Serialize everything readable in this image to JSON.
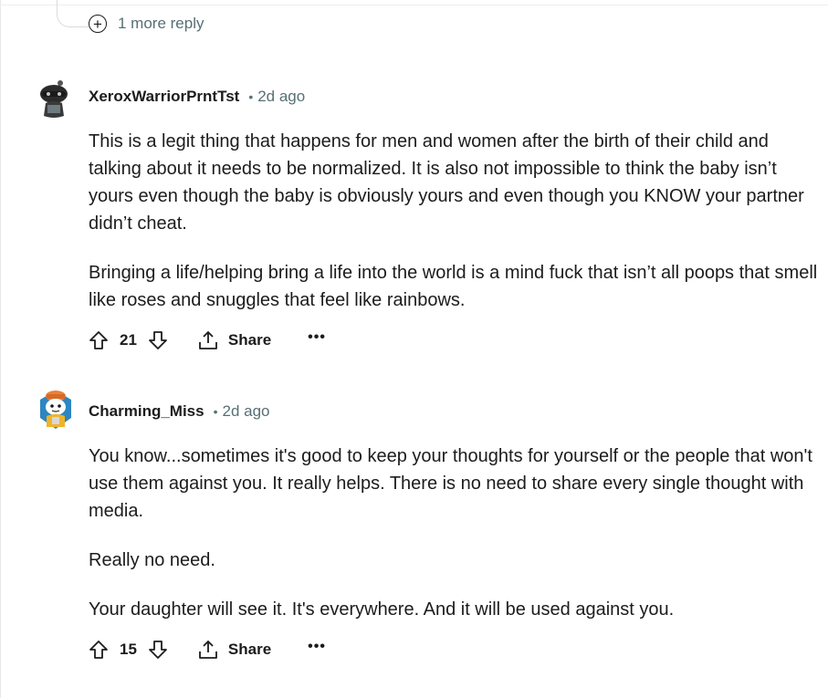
{
  "thread": {
    "more_replies_label": "1 more reply"
  },
  "comments": [
    {
      "author": "XeroxWarriorPrntTst",
      "dot": "•",
      "time": "2d ago",
      "avatar_icon": "snoo-avatar-dark",
      "paragraphs": [
        "This is a legit thing that happens for men and women after the birth of their child and talking about it needs to be normalized. It is also not impossible to think the baby isn’t yours even though the baby is obviously yours and even though you KNOW your partner didn’t cheat.",
        "Bringing a life/helping bring a life into the world is a mind fuck that isn’t all poops that smell like roses and snuggles that feel like rainbows."
      ],
      "score": "21",
      "share_label": "Share",
      "more_label": "•••"
    },
    {
      "author": "Charming_Miss",
      "dot": "•",
      "time": "2d ago",
      "avatar_icon": "snoo-avatar-hat",
      "paragraphs": [
        "You know...sometimes it's good to keep your thoughts for yourself or the people that won't use them against you. It really helps. There is no need to share every single thought with media.",
        "Really no need.",
        "Your daughter will see it. It's everywhere. And it will be used against you."
      ],
      "score": "15",
      "share_label": "Share",
      "more_label": "•••"
    }
  ],
  "colors": {
    "text": "#1c1c1c",
    "meta": "#576f76",
    "rule": "#d7dadc"
  }
}
